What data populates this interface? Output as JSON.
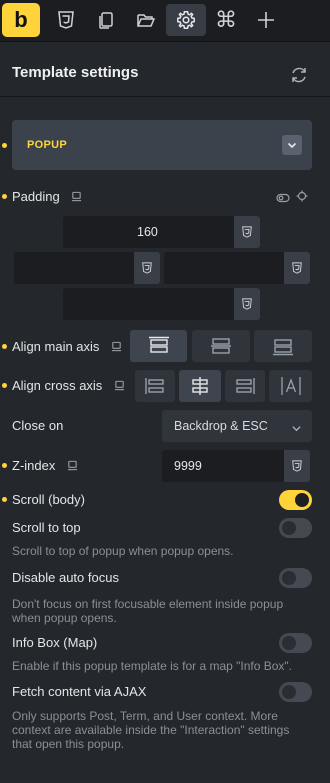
{
  "toolbar": {
    "logo_letter": "b",
    "items": [
      {
        "name": "css3-icon"
      },
      {
        "name": "copy-icon"
      },
      {
        "name": "folder-open-icon"
      },
      {
        "name": "gear-icon",
        "active": true
      },
      {
        "name": "command-icon",
        "glyph": "⌘"
      },
      {
        "name": "plus-icon",
        "glyph": "+"
      }
    ]
  },
  "header": {
    "title": "Template settings",
    "refresh_icon": "refresh-icon"
  },
  "popup_group": {
    "label": "POPUP",
    "expanded": true
  },
  "padding": {
    "label": "Padding",
    "top": "160",
    "left": "",
    "right": "",
    "bottom": ""
  },
  "align_main_axis": {
    "label": "Align main axis",
    "options": [
      "flex-start",
      "center",
      "flex-end"
    ],
    "active": "flex-start"
  },
  "align_cross_axis": {
    "label": "Align cross axis",
    "options": [
      "flex-start",
      "center",
      "flex-end",
      "stretch"
    ],
    "active": "center"
  },
  "close_on": {
    "label": "Close on",
    "value": "Backdrop & ESC"
  },
  "z_index": {
    "label": "Z-index",
    "value": "9999"
  },
  "scroll_body": {
    "label": "Scroll (body)",
    "on": true
  },
  "scroll_to_top": {
    "label": "Scroll to top",
    "on": false,
    "description": "Scroll to top of popup when popup opens."
  },
  "disable_auto_focus": {
    "label": "Disable auto focus",
    "on": false,
    "description": "Don't focus on first focusable element inside popup when popup opens."
  },
  "info_box": {
    "label": "Info Box (Map)",
    "on": false,
    "description": "Enable if this popup template is for a map \"Info Box\"."
  },
  "fetch_ajax": {
    "label": "Fetch content via AJAX",
    "on": false,
    "description": "Only supports Post, Term, and User context. More context are available inside the \"Interaction\" settings that open this popup."
  },
  "colors": {
    "accent": "#ffd43b",
    "background": "#24272c",
    "toolbar": "#1b1d21",
    "input": "#1b1d21",
    "muted_text": "#8a9098"
  }
}
